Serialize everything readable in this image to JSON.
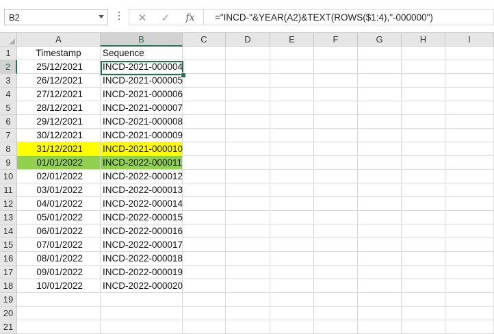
{
  "name_box": {
    "value": "B2"
  },
  "formula_bar": {
    "cancel_icon": "x-icon",
    "enter_icon": "check-icon",
    "fx_label": "fx",
    "formula": "=\"INCD-\"&YEAR(A2)&TEXT(ROWS($1:4),\"-000000\")"
  },
  "columns": [
    "A",
    "B",
    "C",
    "D",
    "E",
    "F",
    "G",
    "H",
    "I"
  ],
  "selected_cell": "B2",
  "rows": [
    {
      "num": "1",
      "a": "Timestamp",
      "b": "Sequence",
      "fill": ""
    },
    {
      "num": "2",
      "a": "25/12/2021",
      "b": "INCD-2021-000004",
      "fill": ""
    },
    {
      "num": "3",
      "a": "26/12/2021",
      "b": "INCD-2021-000005",
      "fill": ""
    },
    {
      "num": "4",
      "a": "27/12/2021",
      "b": "INCD-2021-000006",
      "fill": ""
    },
    {
      "num": "5",
      "a": "28/12/2021",
      "b": "INCD-2021-000007",
      "fill": ""
    },
    {
      "num": "6",
      "a": "29/12/2021",
      "b": "INCD-2021-000008",
      "fill": ""
    },
    {
      "num": "7",
      "a": "30/12/2021",
      "b": "INCD-2021-000009",
      "fill": ""
    },
    {
      "num": "8",
      "a": "31/12/2021",
      "b": "INCD-2021-000010",
      "fill": "#ffff00"
    },
    {
      "num": "9",
      "a": "01/01/2022",
      "b": "INCD-2022-000011",
      "fill": "#92d050"
    },
    {
      "num": "10",
      "a": "02/01/2022",
      "b": "INCD-2022-000012",
      "fill": ""
    },
    {
      "num": "11",
      "a": "03/01/2022",
      "b": "INCD-2022-000013",
      "fill": ""
    },
    {
      "num": "12",
      "a": "04/01/2022",
      "b": "INCD-2022-000014",
      "fill": ""
    },
    {
      "num": "13",
      "a": "05/01/2022",
      "b": "INCD-2022-000015",
      "fill": ""
    },
    {
      "num": "14",
      "a": "06/01/2022",
      "b": "INCD-2022-000016",
      "fill": ""
    },
    {
      "num": "15",
      "a": "07/01/2022",
      "b": "INCD-2022-000017",
      "fill": ""
    },
    {
      "num": "16",
      "a": "08/01/2022",
      "b": "INCD-2022-000018",
      "fill": ""
    },
    {
      "num": "17",
      "a": "09/01/2022",
      "b": "INCD-2022-000019",
      "fill": ""
    },
    {
      "num": "18",
      "a": "10/01/2022",
      "b": "INCD-2022-000020",
      "fill": ""
    },
    {
      "num": "19",
      "a": "",
      "b": "",
      "fill": ""
    },
    {
      "num": "20",
      "a": "",
      "b": "",
      "fill": ""
    },
    {
      "num": "21",
      "a": "",
      "b": "",
      "fill": ""
    }
  ]
}
